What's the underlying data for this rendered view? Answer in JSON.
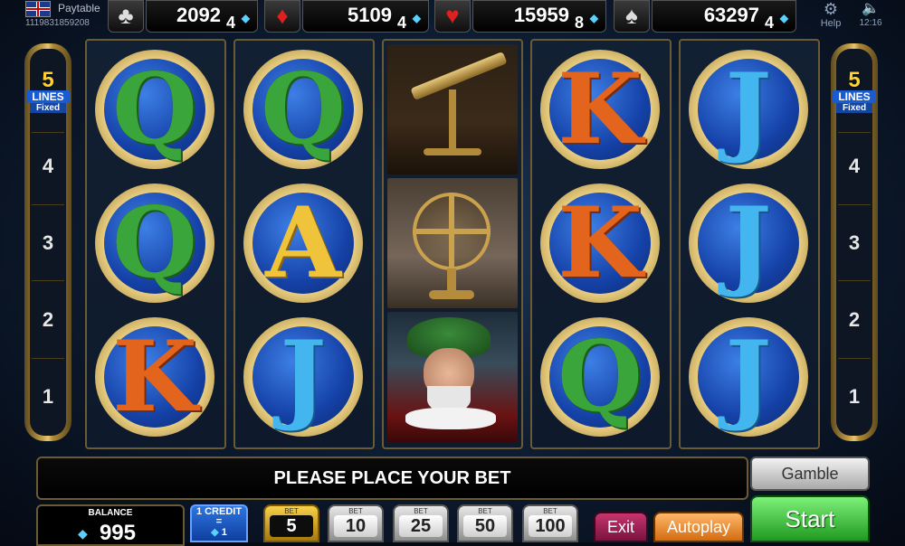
{
  "header": {
    "paytable_label": "Paytable",
    "ticket_id": "1119831859208",
    "help_label": "Help",
    "clock": "12:16",
    "jackpots": [
      {
        "suit": "clubs",
        "symbol": "♣",
        "value": "2092",
        "cents": "4"
      },
      {
        "suit": "diamonds",
        "symbol": "♦",
        "value": "5109",
        "cents": "4"
      },
      {
        "suit": "hearts",
        "symbol": "♥",
        "value": "15959",
        "cents": "8"
      },
      {
        "suit": "spades",
        "symbol": "♠",
        "value": "63297",
        "cents": "4"
      }
    ]
  },
  "lines_panel": {
    "count": "5",
    "label": "LINES",
    "fixed_label": "Fixed",
    "numbers": [
      "4",
      "3",
      "2",
      "1"
    ]
  },
  "reels": [
    [
      "Q",
      "Q",
      "K"
    ],
    [
      "Q",
      "A",
      "J"
    ],
    [
      "telescope",
      "armillary-sphere",
      "astronomer"
    ],
    [
      "K",
      "K",
      "Q"
    ],
    [
      "J",
      "J",
      "J"
    ]
  ],
  "message": "PLEASE PLACE YOUR BET",
  "controls": {
    "gamble_label": "Gamble",
    "balance_label": "BALANCE",
    "balance_value": "995",
    "credit_label": "1 CREDIT",
    "credit_eq": "=",
    "credit_value": "1",
    "bet_label": "BET",
    "bets": [
      "5",
      "10",
      "25",
      "50",
      "100"
    ],
    "selected_bet": "5",
    "exit_label": "Exit",
    "autoplay_label": "Autoplay",
    "start_label": "Start"
  },
  "colors": {
    "lines_accent": "#ffd32a",
    "start_button": "#3cc23c",
    "autoplay_button": "#f08a2a",
    "exit_button": "#a02050",
    "credit_box": "#1f5fd0"
  }
}
